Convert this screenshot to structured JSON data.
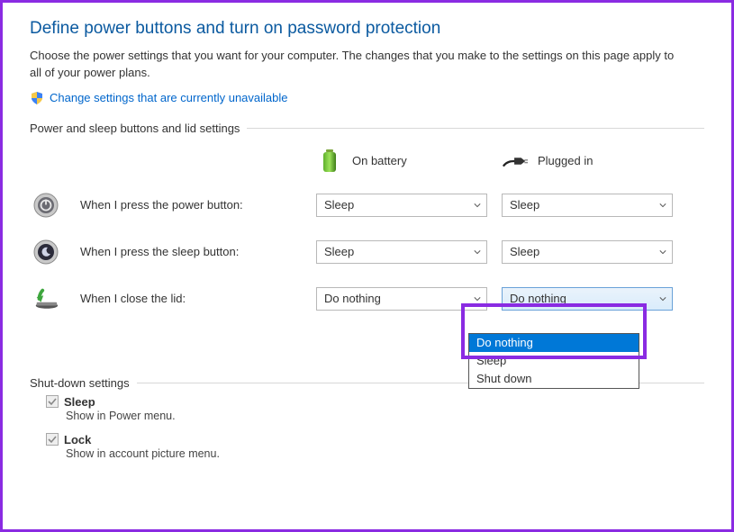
{
  "title": "Define power buttons and turn on password protection",
  "subtitle": "Choose the power settings that you want for your computer. The changes that you make to the settings on this page apply to all of your power plans.",
  "changeLink": "Change settings that are currently unavailable",
  "section1": "Power and sleep buttons and lid settings",
  "header": {
    "battery": "On battery",
    "plugged": "Plugged in"
  },
  "rows": {
    "power": {
      "label": "When I press the power button:",
      "battery": "Sleep",
      "plugged": "Sleep"
    },
    "sleep": {
      "label": "When I press the sleep button:",
      "battery": "Sleep",
      "plugged": "Sleep"
    },
    "lid": {
      "label": "When I close the lid:",
      "battery": "Do nothing",
      "plugged": "Do nothing"
    }
  },
  "dropdownOptions": [
    "Do nothing",
    "Sleep",
    "Shut down"
  ],
  "section2": "Shut-down settings",
  "shutdown": {
    "sleep": {
      "label": "Sleep",
      "desc": "Show in Power menu."
    },
    "lock": {
      "label": "Lock",
      "desc": "Show in account picture menu."
    }
  }
}
